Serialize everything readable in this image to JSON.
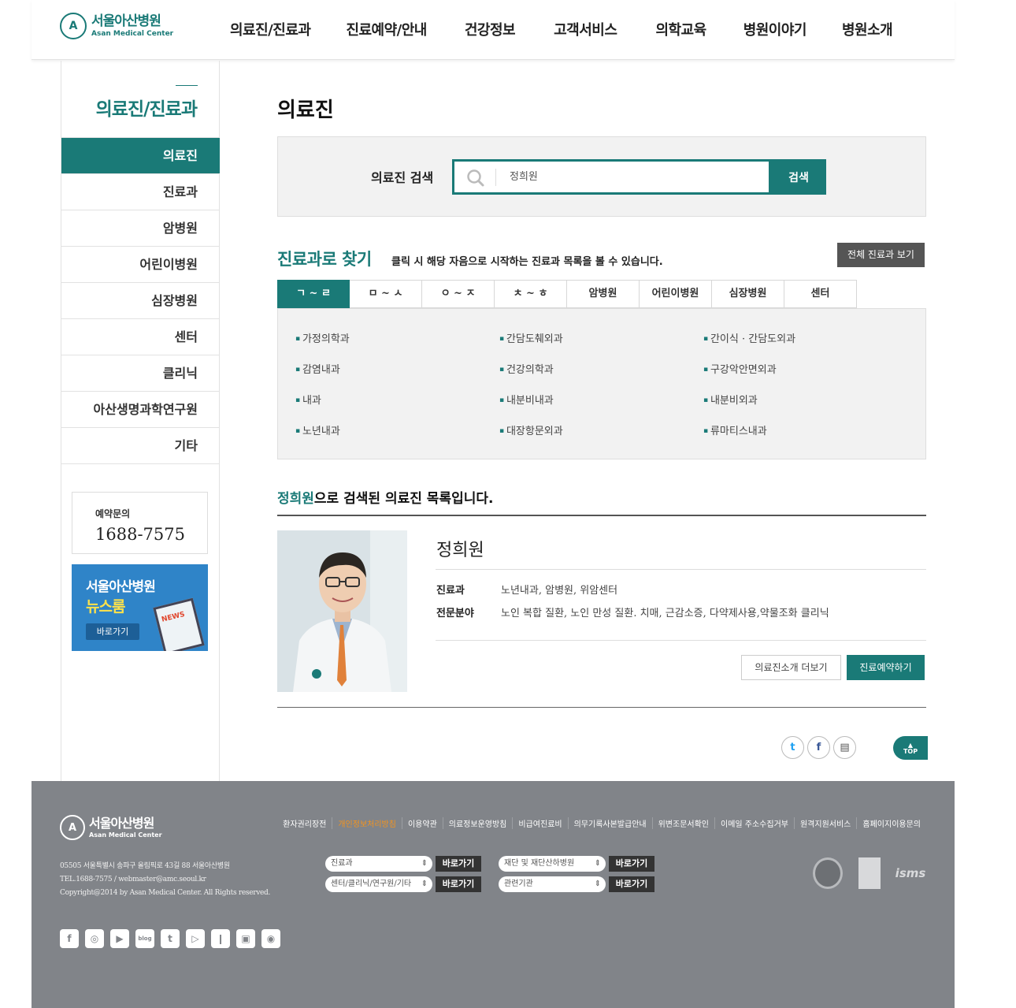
{
  "header": {
    "logo_ko": "서울아산병원",
    "logo_en": "Asan Medical Center",
    "gnb": [
      "의료진/진료과",
      "진료예약/안내",
      "건강정보",
      "고객서비스",
      "의학교육",
      "병원이야기",
      "병원소개"
    ]
  },
  "sidebar": {
    "title": "의료진/진료과",
    "items": [
      {
        "label": "의료진",
        "active": true
      },
      {
        "label": "진료과"
      },
      {
        "label": "암병원"
      },
      {
        "label": "어린이병원"
      },
      {
        "label": "심장병원"
      },
      {
        "label": "센터"
      },
      {
        "label": "클리닉"
      },
      {
        "label": "아산생명과학연구원"
      },
      {
        "label": "기타"
      }
    ],
    "reserve_label": "예약문의",
    "reserve_number": "1688-7575",
    "news_banner": {
      "line1": "서울아산병원",
      "line2": "뉴스룸",
      "button": "바로가기",
      "tag": "NEWS"
    }
  },
  "main": {
    "page_title": "의료진",
    "search": {
      "label": "의료진 검색",
      "value": "정희원",
      "button": "검색"
    },
    "find": {
      "title": "진료과로 찾기",
      "desc": "클릭 시 해당 자음으로 시작하는 진료과 목록을 볼 수 있습니다.",
      "all_button": "전체 진료과 보기",
      "tabs": [
        "ㄱ ~ ㄹ",
        "ㅁ ~ ㅅ",
        "ㅇ ~ ㅈ",
        "ㅊ ~ ㅎ",
        "암병원",
        "어린이병원",
        "심장병원",
        "센터"
      ],
      "departments": [
        "가정의학과",
        "간담도췌외과",
        "간이식 · 간담도외과",
        "감염내과",
        "건강의학과",
        "구강악안면외과",
        "내과",
        "내분비내과",
        "내분비외과",
        "노년내과",
        "대장항문외과",
        "류마티스내과"
      ]
    },
    "result": {
      "keyword": "정희원",
      "suffix": "으로 검색된 의료진 목록입니다.",
      "doctor": {
        "name": "정희원",
        "dept_label": "진료과",
        "dept_value": "노년내과, 암병원, 위암센터",
        "field_label": "전문분야",
        "field_value": "노인 복합 질환, 노인 만성 질환. 치매, 근감소증, 다약제사용,약물조화 클리닉"
      },
      "more_button": "의료진소개 더보기",
      "book_button": "진료예약하기"
    },
    "share": {
      "twitter": "twitter-icon",
      "facebook": "facebook-icon",
      "print": "print-icon"
    },
    "top_button": "TOP"
  },
  "footer": {
    "logo_ko": "서울아산병원",
    "logo_en": "Asan Medical Center",
    "links": [
      "환자권리장전",
      "개인정보처리방침",
      "이용약관",
      "의료정보운영방침",
      "비급여진료비",
      "의무기록사본발급안내",
      "위변조문서확인",
      "이메일 주소수집거부",
      "원격지원서비스",
      "홈페이지이용문의"
    ],
    "address": "05505 서울특별시 송파구 올림픽로 43길 88 서울아산병원",
    "tel": "TEL.1688-7575 / webmaster@amc.seoul.kr",
    "copyright": "Copyright@2014 by Asan Medical Center. All Rights reserved.",
    "selects": [
      {
        "label": "진료과",
        "button": "바로가기"
      },
      {
        "label": "센터/클리닉/연구원/기타",
        "button": "바로가기"
      },
      {
        "label": "재단 및 재단산하병원",
        "button": "바로가기"
      },
      {
        "label": "관련기관",
        "button": "바로가기"
      }
    ],
    "badge_isms": "isms",
    "sns": [
      "facebook-icon",
      "instagram-icon",
      "youtube-icon",
      "blog-icon",
      "twitter-icon",
      "play-icon",
      "storyfunding-icon",
      "podcast-icon",
      "video-icon"
    ],
    "sns_blog_text": "blog"
  },
  "colors": {
    "brand": "#1a7a77",
    "footer_bg": "#818489",
    "highlight": "#f3941f"
  }
}
